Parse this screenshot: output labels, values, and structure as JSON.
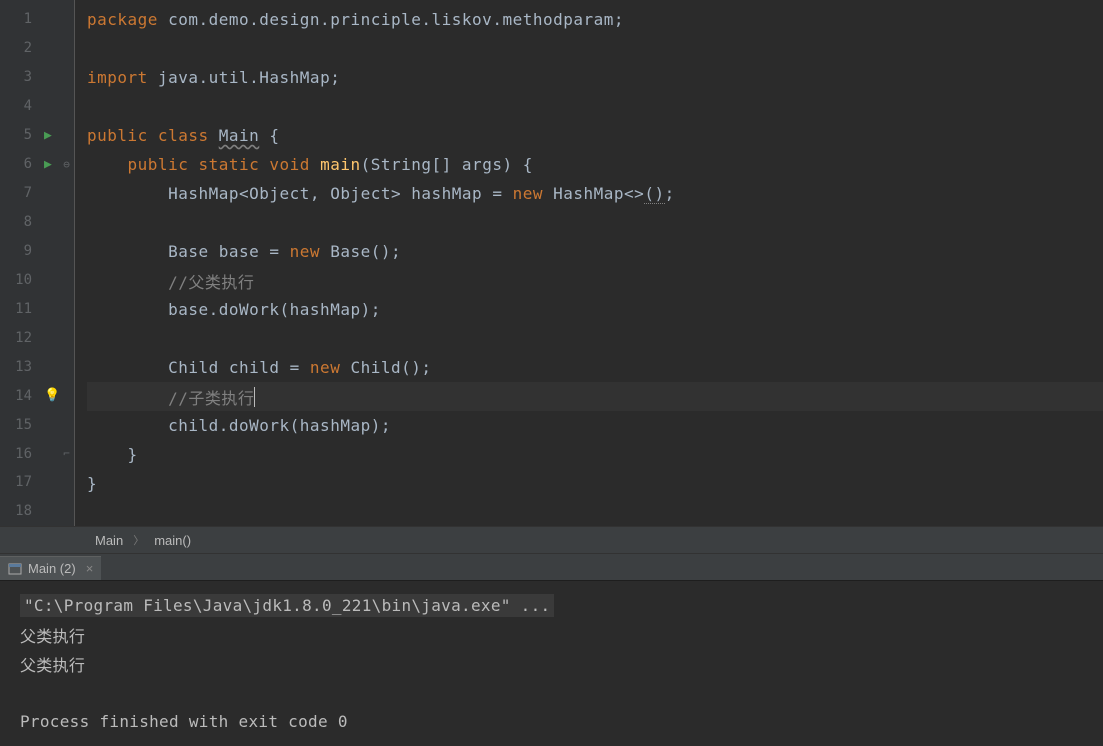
{
  "code": {
    "line1": {
      "kw1": "package ",
      "pkg": "com.demo.design.principle.liskov.methodparam",
      "end": ";"
    },
    "line3": {
      "kw1": "import ",
      "pkg": "java.util.HashMap",
      "end": ";"
    },
    "line5": {
      "kw1": "public class ",
      "cls": "Main",
      "brace": " {"
    },
    "line6": {
      "indent": "    ",
      "kw1": "public static ",
      "kw2": "void ",
      "method": "main",
      "params": "(String[] args) {"
    },
    "line7": {
      "indent": "        ",
      "type1": "HashMap<Object, Object> hashMap = ",
      "kw": "new ",
      "type2": "HashMap<>",
      "paren": "()",
      "end": ";"
    },
    "line9": {
      "indent": "        ",
      "type": "Base base = ",
      "kw": "new ",
      "ctor": "Base()",
      "end": ";"
    },
    "line10": {
      "indent": "        ",
      "comment": "//父类执行"
    },
    "line11": {
      "indent": "        ",
      "call": "base.doWork(hashMap)",
      "end": ";"
    },
    "line13": {
      "indent": "        ",
      "type": "Child child = ",
      "kw": "new ",
      "ctor": "Child()",
      "end": ";"
    },
    "line14": {
      "indent": "        ",
      "comment": "//子类执行"
    },
    "line15": {
      "indent": "        ",
      "call": "child.doWork(hashMap)",
      "end": ";"
    },
    "line16": {
      "indent": "    ",
      "brace": "}"
    },
    "line17": {
      "brace": "}"
    }
  },
  "lineNumbers": [
    "1",
    "2",
    "3",
    "4",
    "5",
    "6",
    "7",
    "8",
    "9",
    "10",
    "11",
    "12",
    "13",
    "14",
    "15",
    "16",
    "17",
    "18"
  ],
  "breadcrumb": {
    "item1": "Main",
    "item2": "main()"
  },
  "consoleTab": {
    "label": "Main (2)"
  },
  "console": {
    "line1": "\"C:\\Program Files\\Java\\jdk1.8.0_221\\bin\\java.exe\" ...",
    "line2": "父类执行",
    "line3": "父类执行",
    "line5": "Process finished with exit code 0"
  }
}
